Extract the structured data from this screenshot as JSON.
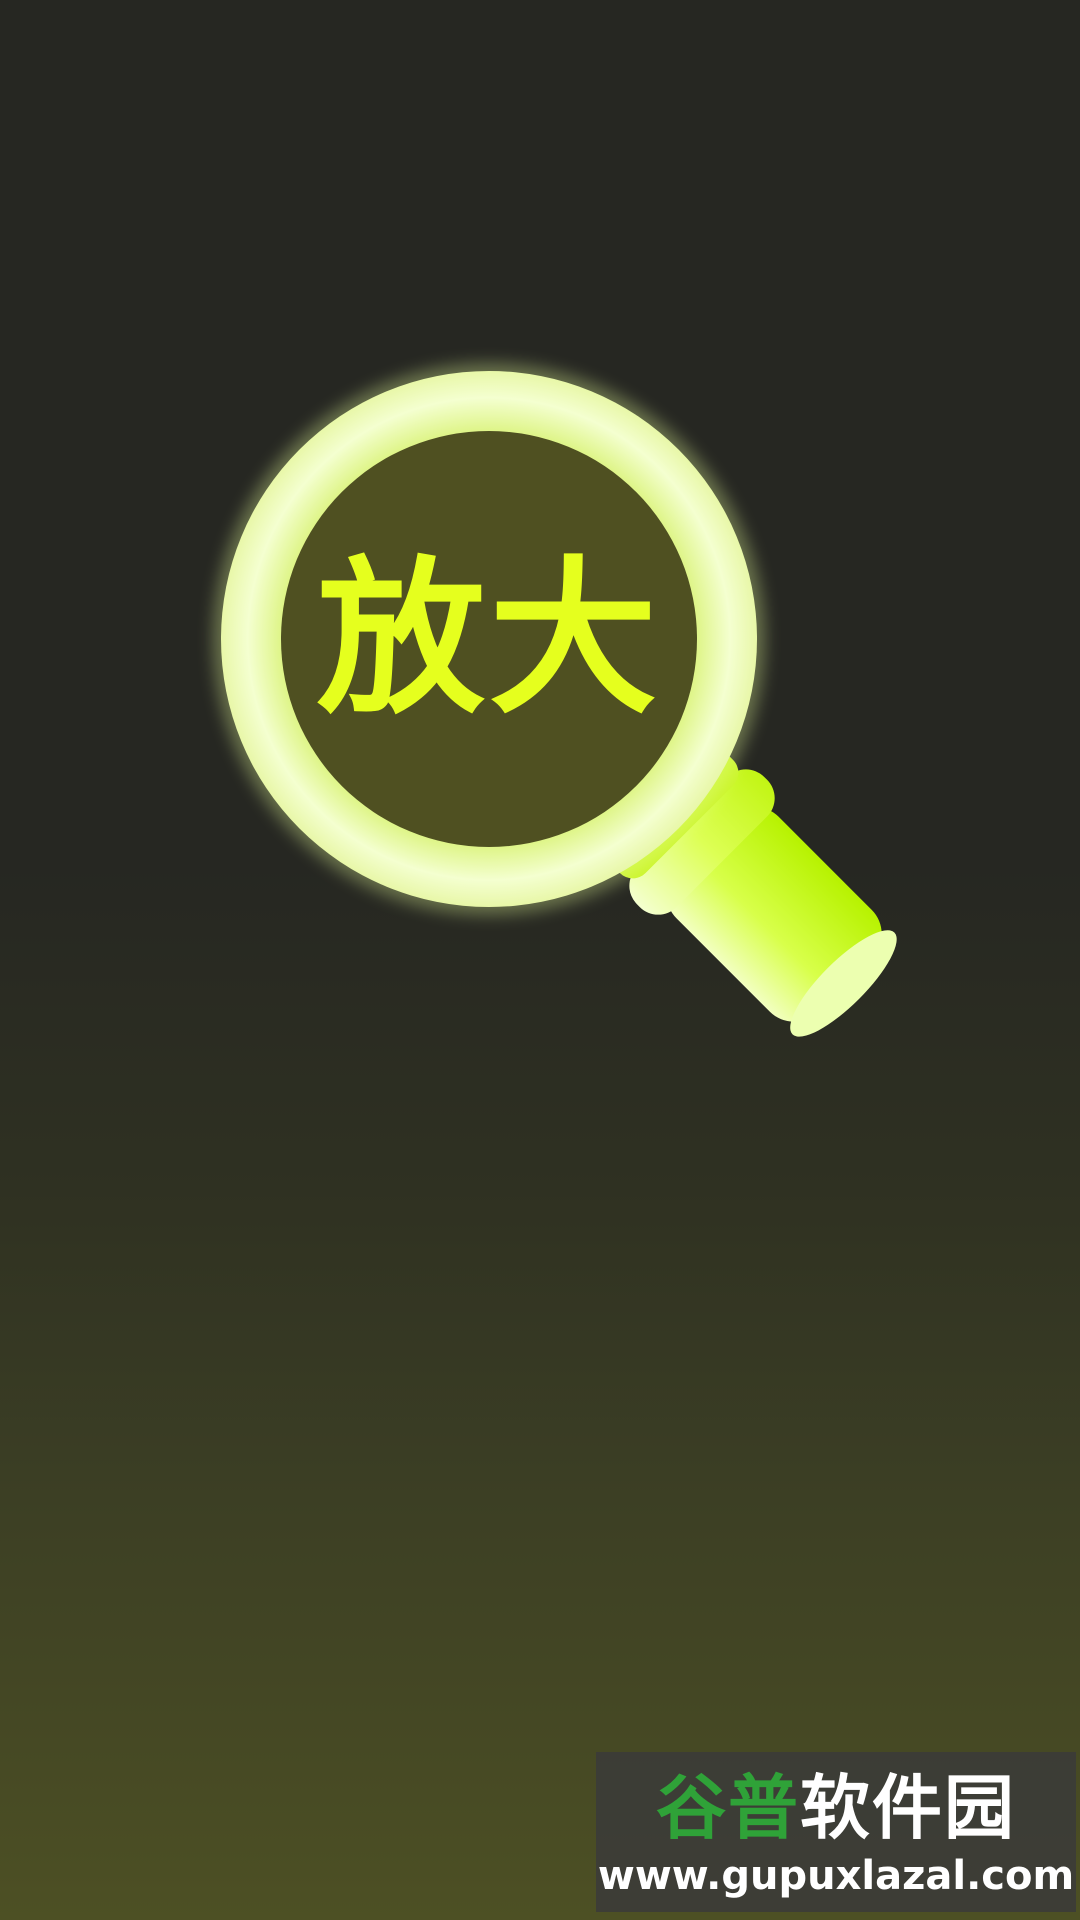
{
  "splash": {
    "icon": "magnifier-icon",
    "label": "放大"
  },
  "colors": {
    "background_top": "#262722",
    "background_bottom": "#4d5024",
    "lens_fill": "#4f5021",
    "lens_rim": "#eefcb4",
    "handle": "#c6ff1a",
    "label": "#e5ff1e"
  },
  "watermark": {
    "brand_part1": "谷普",
    "brand_part2": "软件园",
    "url": "www.gupuxlazal.com"
  }
}
